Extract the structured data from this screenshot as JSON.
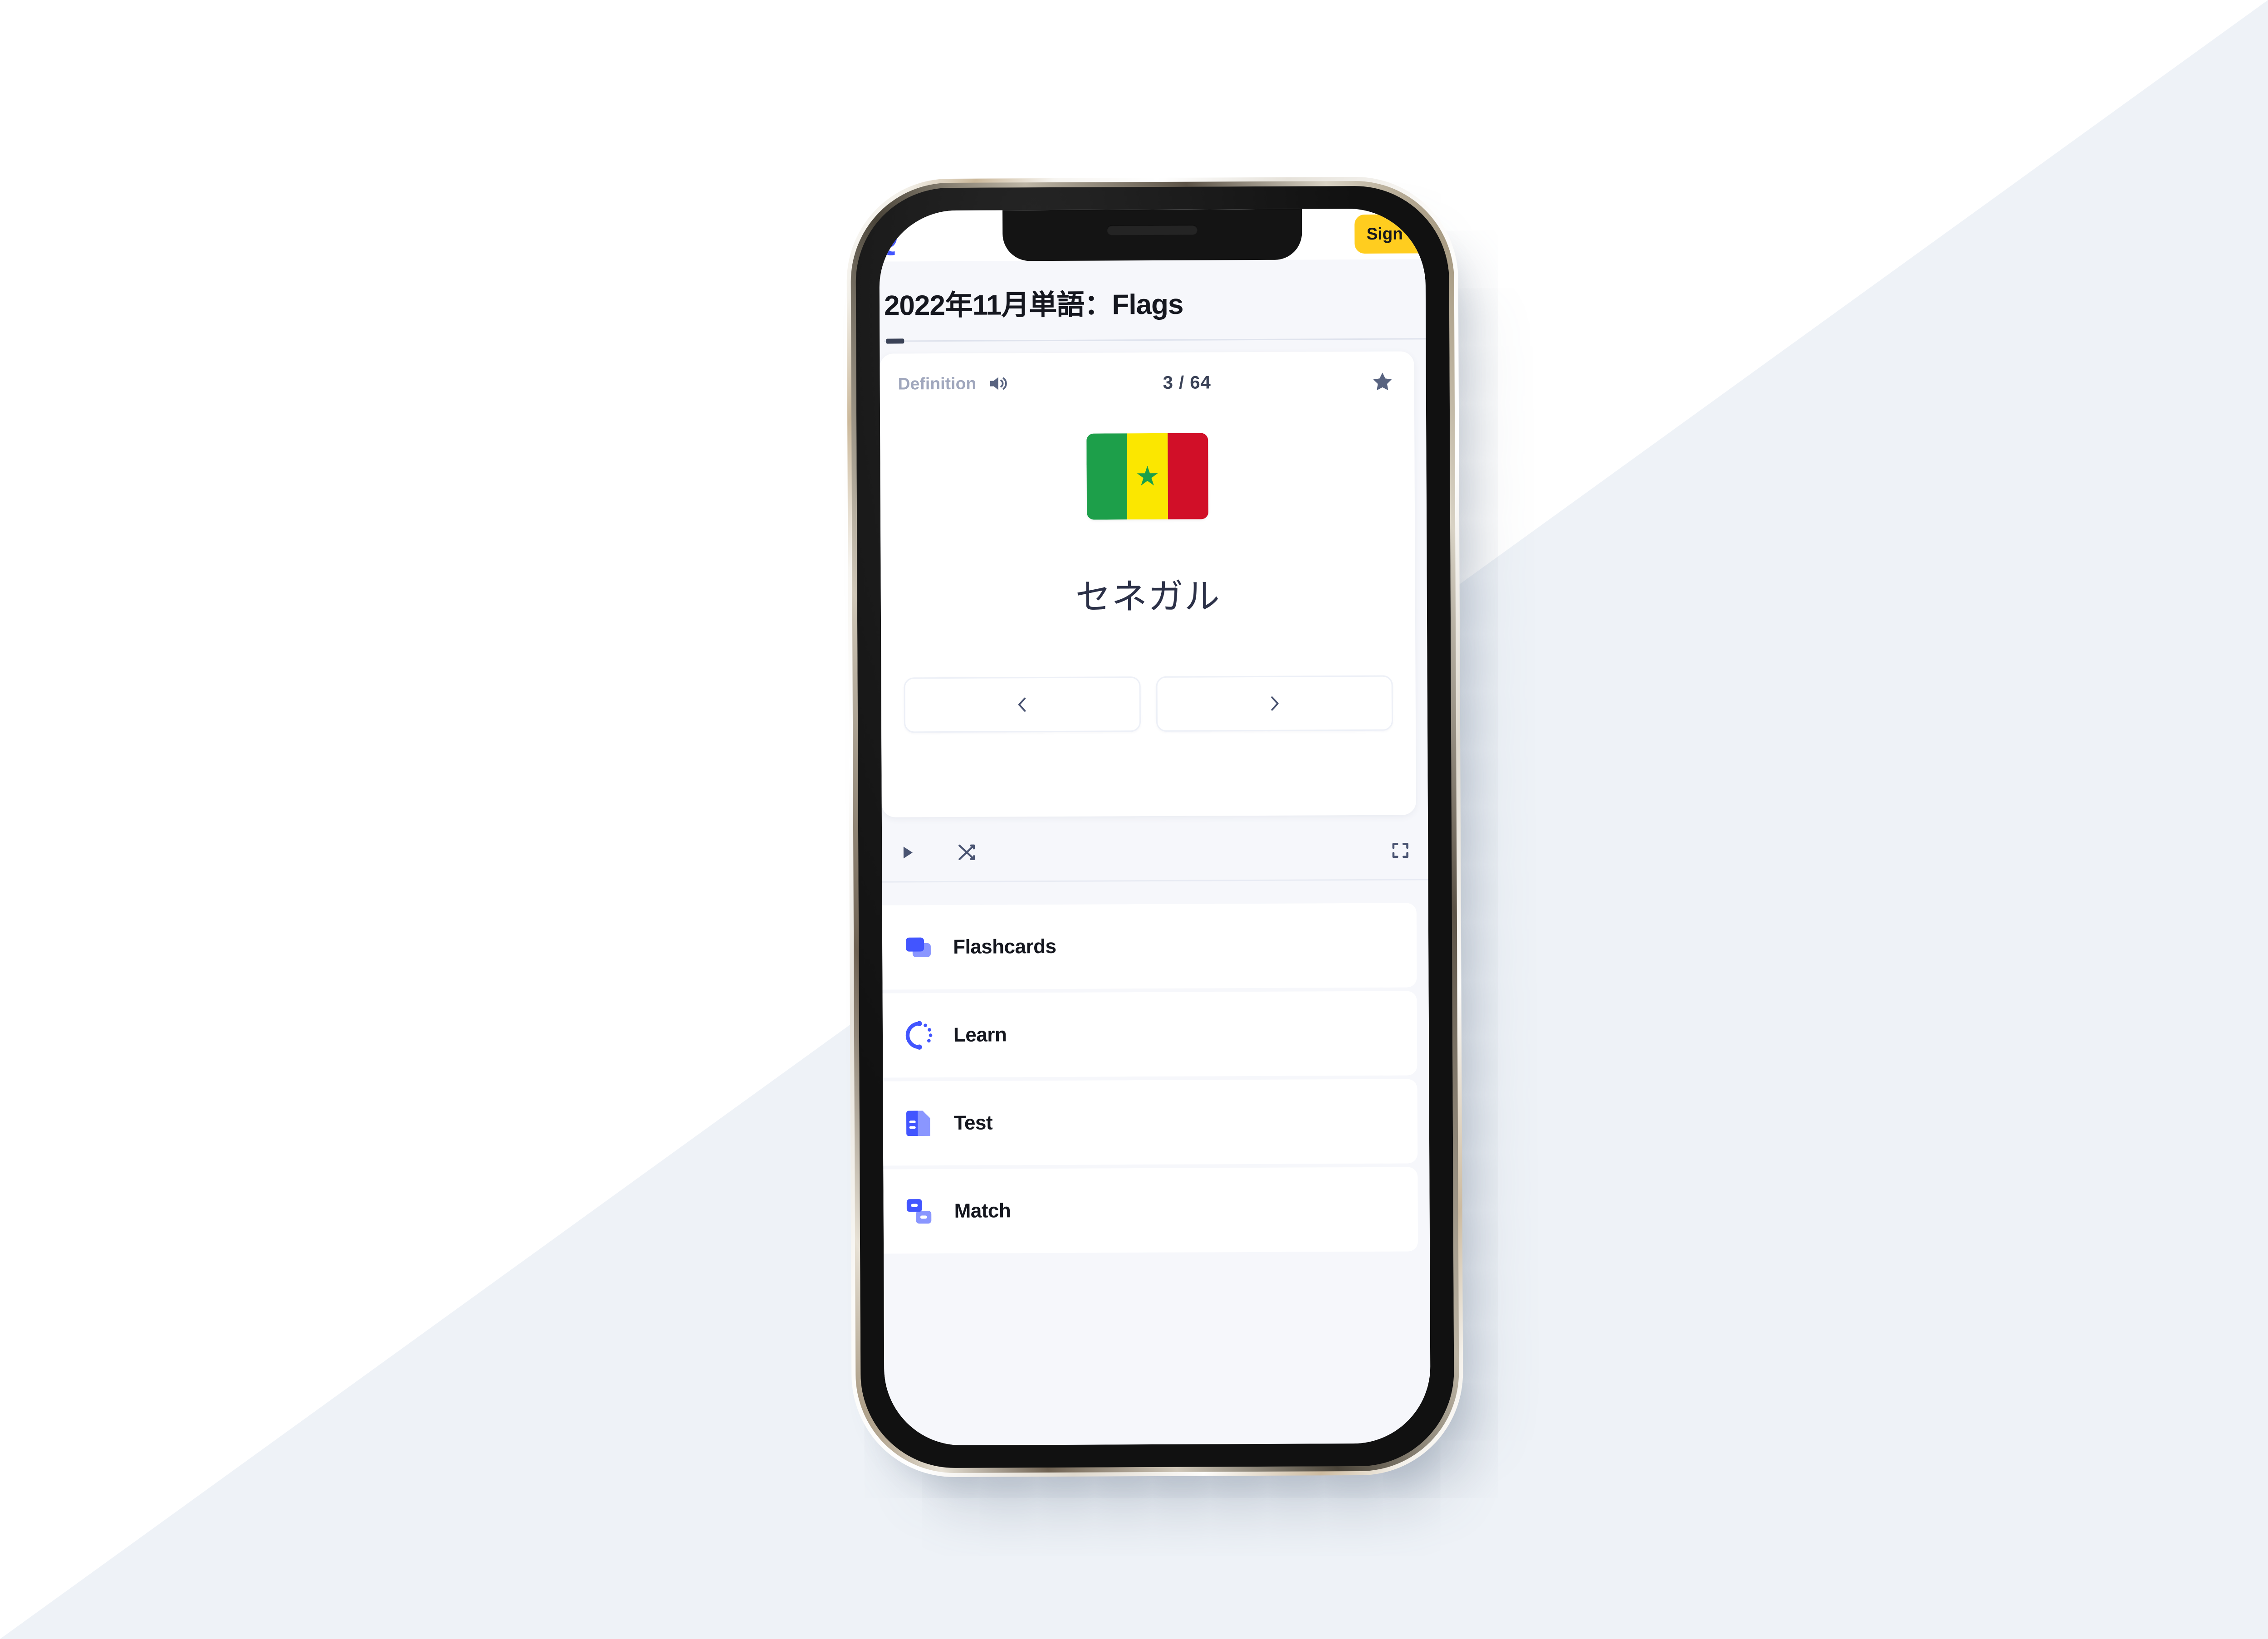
{
  "background": {
    "base_color": "#ffffff",
    "accent_color": "#eef2f7"
  },
  "device": {
    "kind": "smartphone-mockup",
    "frame_color": "#131313"
  },
  "app": {
    "navbar": {
      "logo_text": "Q",
      "logo_color": "#4255ff",
      "signup_label": "Sign up",
      "signup_bg": "#ffcd1f"
    },
    "page_title": "2022年11月単語：Flags"
  },
  "flashcard": {
    "side_label": "Definition",
    "audio_icon": "speaker-icon",
    "counter": "3 / 64",
    "counter_current": 3,
    "counter_total": 64,
    "star_icon": "star-icon",
    "star_color": "#586380",
    "image": {
      "name": "senegal-flag",
      "bands": [
        "#1d9f4a",
        "#fbe700",
        "#d10f28"
      ],
      "star_glyph": "★",
      "star_color": "#18a04a"
    },
    "term": "セネガル",
    "prev_icon": "chevron-left-icon",
    "next_icon": "chevron-right-icon"
  },
  "toolbar": {
    "play_icon": "play-icon",
    "shuffle_icon": "shuffle-icon",
    "fullscreen_icon": "fullscreen-icon",
    "icon_color": "#586380"
  },
  "modes": {
    "accent": "#4255ff",
    "items": [
      {
        "label": "Flashcards",
        "icon": "flashcards-icon"
      },
      {
        "label": "Learn",
        "icon": "learn-icon"
      },
      {
        "label": "Test",
        "icon": "test-icon"
      },
      {
        "label": "Match",
        "icon": "match-icon"
      }
    ]
  }
}
